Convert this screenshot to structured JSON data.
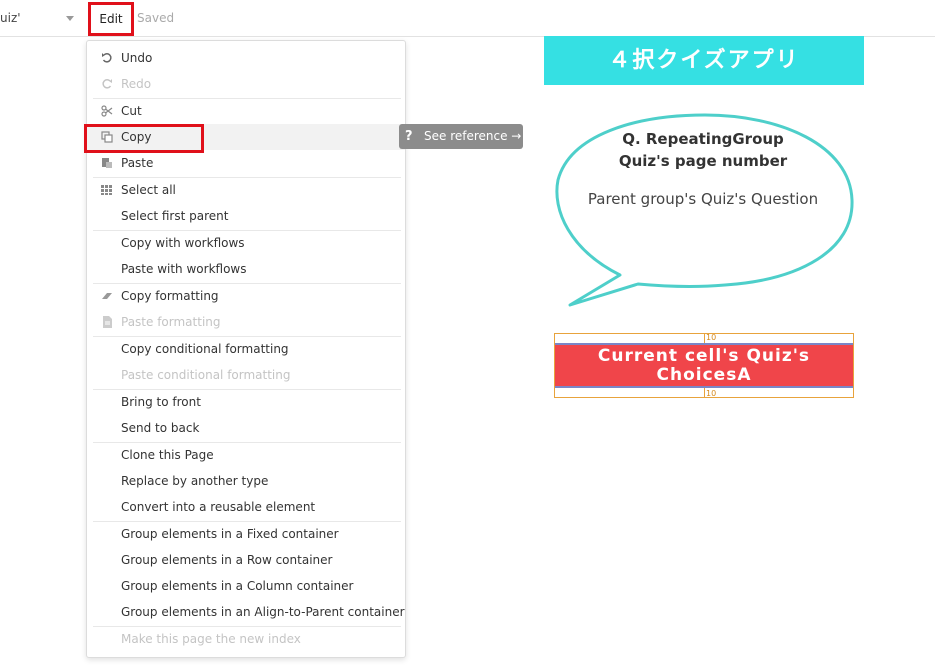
{
  "topbar": {
    "page_name": "uiz'",
    "edit_label": "Edit",
    "saved_label": "Saved"
  },
  "menu": {
    "items": [
      {
        "label": "Undo",
        "icon": "undo-icon",
        "disabled": false
      },
      {
        "label": "Redo",
        "icon": "redo-icon",
        "disabled": true
      },
      {
        "label": "Cut",
        "icon": "scissors-icon",
        "disabled": false
      },
      {
        "label": "Copy",
        "icon": "copy-icon",
        "disabled": false
      },
      {
        "label": "Paste",
        "icon": "paste-icon",
        "disabled": false
      },
      {
        "label": "Select all",
        "icon": "grid-icon",
        "disabled": false
      },
      {
        "label": "Select first parent",
        "icon": "",
        "disabled": false
      },
      {
        "label": "Copy with workflows",
        "icon": "",
        "disabled": false
      },
      {
        "label": "Paste with workflows",
        "icon": "",
        "disabled": false
      },
      {
        "label": "Copy formatting",
        "icon": "eraser-icon",
        "disabled": false
      },
      {
        "label": "Paste formatting",
        "icon": "document-icon",
        "disabled": true
      },
      {
        "label": "Copy conditional formatting",
        "icon": "",
        "disabled": false
      },
      {
        "label": "Paste conditional formatting",
        "icon": "",
        "disabled": true
      },
      {
        "label": "Bring to front",
        "icon": "",
        "disabled": false
      },
      {
        "label": "Send to back",
        "icon": "",
        "disabled": false
      },
      {
        "label": "Clone this Page",
        "icon": "",
        "disabled": false
      },
      {
        "label": "Replace by another type",
        "icon": "",
        "disabled": false
      },
      {
        "label": "Convert into a reusable element",
        "icon": "",
        "disabled": false
      },
      {
        "label": "Group elements in a Fixed container",
        "icon": "",
        "disabled": false
      },
      {
        "label": "Group elements in a Row container",
        "icon": "",
        "disabled": false
      },
      {
        "label": "Group elements in a Column container",
        "icon": "",
        "disabled": false
      },
      {
        "label": "Group elements in an Align-to-Parent container",
        "icon": "",
        "disabled": false
      },
      {
        "label": "Make this page the new index",
        "icon": "",
        "disabled": true
      }
    ]
  },
  "tooltip": {
    "icon_text": "?",
    "label": "See reference →"
  },
  "canvas": {
    "banner_text": "４択クイズアプリ",
    "question_title_line1": "Q. RepeatingGroup",
    "question_title_line2": "Quiz's page number",
    "question_text": "Parent group's Quiz's Question",
    "choice_line1": "Current cell's Quiz's",
    "choice_line2": "ChoicesA",
    "padding_top": "10",
    "padding_bottom": "10"
  },
  "colors": {
    "highlight_red": "#e0101a",
    "banner_cyan": "#35e0e3",
    "button_red": "#f0454a",
    "selection_orange": "#e8a33c"
  }
}
